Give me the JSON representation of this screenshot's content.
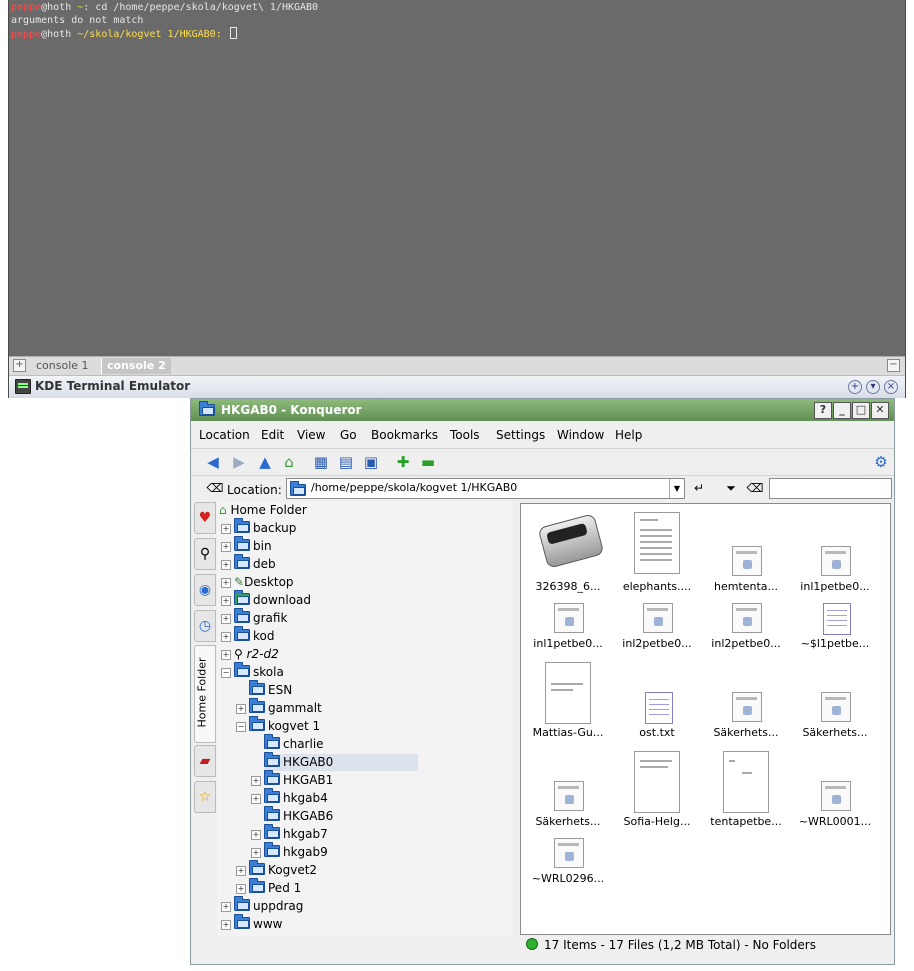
{
  "terminal": {
    "lines": [
      {
        "user": "peppe",
        "host": "@hoth ",
        "path": "~",
        "prompt": ": ",
        "cmd": "cd /home/peppe/skola/kogvet\\ 1/HKGAB0"
      },
      {
        "output": "arguments do not match"
      },
      {
        "user": "peppe",
        "host": "@hoth ",
        "path": "~/skola/kogvet 1/HKGAB0",
        "prompt": ": "
      }
    ],
    "tabs": [
      "console 1",
      "console 2"
    ],
    "title": "KDE Terminal Emulator"
  },
  "konqueror": {
    "title": "HKGAB0 - Konqueror",
    "menu": [
      "Location",
      "Edit",
      "View",
      "Go",
      "Bookmarks",
      "Tools",
      "Settings",
      "Window",
      "Help"
    ],
    "location_label": "Location:",
    "location_value": "/home/peppe/skola/kogvet 1/HKGAB0",
    "side_tab_label": "Home Folder",
    "tree": [
      {
        "label": "Home Folder",
        "icon": "home-icon"
      },
      {
        "label": "backup"
      },
      {
        "label": "bin"
      },
      {
        "label": "deb"
      },
      {
        "label": "Desktop"
      },
      {
        "label": "download"
      },
      {
        "label": "grafik"
      },
      {
        "label": "kod"
      },
      {
        "label": "r2-d2"
      },
      {
        "label": "skola"
      },
      {
        "label": "ESN"
      },
      {
        "label": "gammalt"
      },
      {
        "label": "kogvet 1"
      },
      {
        "label": "charlie"
      },
      {
        "label": "HKGAB0"
      },
      {
        "label": "HKGAB1"
      },
      {
        "label": "hkgab4"
      },
      {
        "label": "HKGAB6"
      },
      {
        "label": "hkgab7"
      },
      {
        "label": "hkgab9"
      },
      {
        "label": "Kogvet2"
      },
      {
        "label": "Ped 1"
      },
      {
        "label": "uppdrag"
      },
      {
        "label": "www"
      }
    ],
    "files": [
      {
        "name": "326398_6...",
        "icon": "photo-remote"
      },
      {
        "name": "elephants....",
        "icon": "document-preview"
      },
      {
        "name": "hemtenta...",
        "icon": "word-document"
      },
      {
        "name": "inl1petbe0...",
        "icon": "word-document"
      },
      {
        "name": "inl1petbe0...",
        "icon": "word-document"
      },
      {
        "name": "inl2petbe0...",
        "icon": "word-document"
      },
      {
        "name": "inl2petbe0...",
        "icon": "word-document"
      },
      {
        "name": "~$l1petbe...",
        "icon": "text-document"
      },
      {
        "name": "Mattias-Gu...",
        "icon": "document-preview"
      },
      {
        "name": "ost.txt",
        "icon": "text-document"
      },
      {
        "name": "Säkerhets...",
        "icon": "word-document"
      },
      {
        "name": "Säkerhets...",
        "icon": "word-document"
      },
      {
        "name": "Säkerhets...",
        "icon": "word-document"
      },
      {
        "name": "Sofia-Helg...",
        "icon": "document-preview"
      },
      {
        "name": "tentapetbe...",
        "icon": "document-preview"
      },
      {
        "name": "~WRL0001...",
        "icon": "word-document"
      },
      {
        "name": "~WRL0296...",
        "icon": "word-document"
      }
    ],
    "status": "17 Items - 17 Files (1,2 MB Total) - No Folders"
  }
}
